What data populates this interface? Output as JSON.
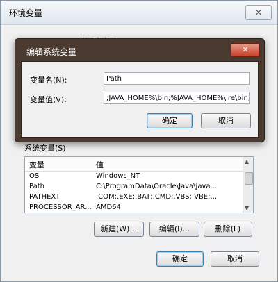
{
  "outer": {
    "title": "环境变量",
    "close_label": "✕",
    "user_vars_caption": "Administrator 的用户变量(U)",
    "system_vars_caption": "系统变量(S)",
    "system_vars": {
      "columns": [
        "变量",
        "值"
      ],
      "rows": [
        {
          "name": "OS",
          "value": "Windows_NT"
        },
        {
          "name": "Path",
          "value": "C:\\ProgramData\\Oracle\\Java\\java..."
        },
        {
          "name": "PATHEXT",
          "value": ".COM;.EXE;.BAT;.CMD;.VBS;.VBE;..."
        },
        {
          "name": "PROCESSOR_AR...",
          "value": "AMD64"
        }
      ]
    },
    "buttons": {
      "new": "新建(W)...",
      "edit": "编辑(I)...",
      "delete": "删除(L)",
      "ok": "确定",
      "cancel": "取消"
    }
  },
  "modal": {
    "title": "编辑系统变量",
    "close_label": "✕",
    "name_label": "变量名(N):",
    "name_value": "Path",
    "value_label": "变量值(V):",
    "value_value": ";JAVA_HOME%\\bin;%JAVA_HOME%\\jre\\bin;",
    "ok": "确定",
    "cancel": "取消"
  },
  "colors": {
    "modal_frame": "#4a3a30",
    "close_red": "#c5402a",
    "window_bg": "#f0f0f0"
  }
}
